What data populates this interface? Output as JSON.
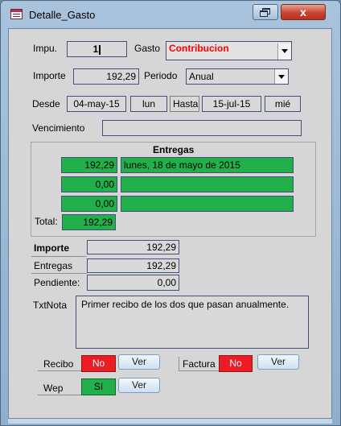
{
  "window": {
    "title": "Detalle_Gasto",
    "close_label": "x"
  },
  "labels": {
    "impu": "Impu.",
    "gasto": "Gasto",
    "importe": "Importe",
    "periodo": "Periodo",
    "desde": "Desde",
    "hasta": "Hasta",
    "vencimiento": "Vencimiento",
    "entregas": "Entregas",
    "total": "Total:",
    "summary_importe": "Importe",
    "summary_entregas": "Entregas",
    "pendiente": "Pendiente:",
    "txtnota": "TxtNota",
    "recibo": "Recibo",
    "factura": "Factura",
    "wep": "Wep"
  },
  "fields": {
    "impu": "1",
    "gasto": "Contribucion",
    "importe": "192,29",
    "periodo": "Anual",
    "desde_date": "04-may-15",
    "desde_day": "lun",
    "hasta_date": "15-jul-15",
    "hasta_day": "mié",
    "vencimiento": ""
  },
  "entregas": {
    "rows": [
      {
        "amount": "192,29",
        "date": "lunes, 18 de mayo de 2015"
      },
      {
        "amount": "0,00",
        "date": ""
      },
      {
        "amount": "0,00",
        "date": ""
      }
    ],
    "total": "192,29"
  },
  "summary": {
    "importe": "192,29",
    "entregas": "192,29",
    "pendiente": "0,00"
  },
  "nota": "Primer recibo de los dos que pasan anualmente.",
  "flags": {
    "recibo": "No",
    "factura": "No",
    "wep": "Sí",
    "ver_label": "Ver"
  },
  "colors": {
    "green": "#21b04a",
    "red": "#ed1c24",
    "gasto_text": "#ff0000"
  }
}
